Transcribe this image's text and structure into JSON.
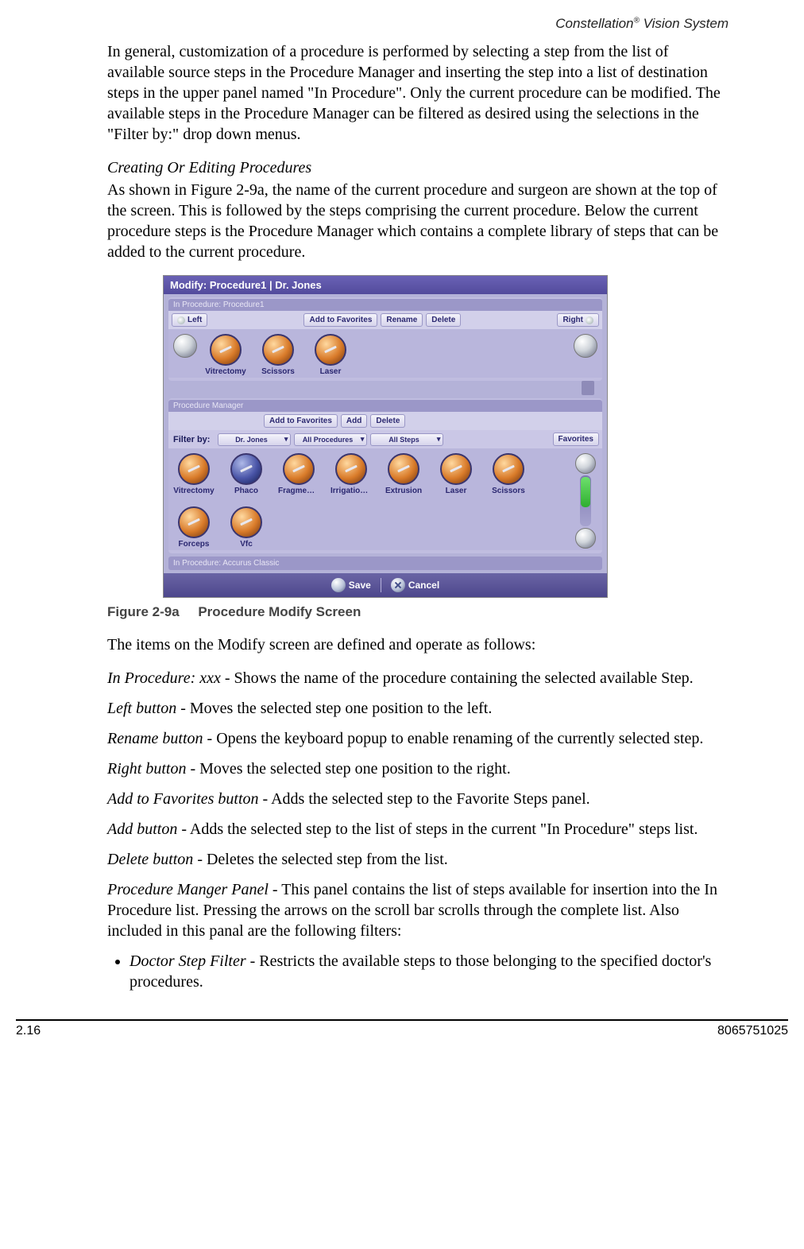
{
  "header": "Constellation® Vision System",
  "para1": "In general, customization of a procedure is performed by selecting a step from the list of available source steps in the Procedure Manager and inserting the step into a list of destination steps in the upper panel named \"In Procedure\".  Only the current procedure can be modified. The available steps in the Procedure Manager can be filtered as desired using the selections in the \"Filter by:\" drop down menus.",
  "subhead1": "Creating Or Editing Procedures",
  "para2": "As shown in Figure 2-9a, the name of the current procedure and surgeon are shown at the top of the screen. This is followed by the steps comprising the current procedure. Below the current procedure steps is the Procedure Manager which contains a complete library of steps that can be added to the current procedure.",
  "fig": {
    "caption_a": "Figure 2-9a",
    "caption_b": "Procedure Modify Screen",
    "titlebar": "Modify:   Procedure1  |  Dr. Jones",
    "inproc": {
      "title": "In Procedure:   Procedure1",
      "left": "Left",
      "addfav": "Add to Favorites",
      "rename": "Rename",
      "delete": "Delete",
      "right": "Right",
      "steps": [
        "Vitrectomy",
        "Scissors",
        "Laser"
      ]
    },
    "mgr": {
      "title": "Procedure Manager",
      "addfav": "Add to Favorites",
      "add": "Add",
      "delete": "Delete",
      "filter_label": "Filter by:",
      "filters": [
        "Dr. Jones",
        "All Procedures",
        "All Steps"
      ],
      "favorites": "Favorites",
      "steps": [
        "Vitrectomy",
        "Phaco",
        "Fragmentati",
        "IrrigationAs",
        "Extrusion",
        "Laser",
        "Scissors",
        "Forceps",
        "Vfc"
      ]
    },
    "subpanel": "In Procedure:   Accurus Classic",
    "save": "Save",
    "cancel": "Cancel"
  },
  "para3": "The items on the Modify screen are defined and operate as follows:",
  "defs": [
    {
      "t": "In Procedure: xxx",
      "d": " - Shows the name of the procedure containing the selected available Step."
    },
    {
      "t": "Left button",
      "d": " - Moves the selected step one position to the left."
    },
    {
      "t": "Rename button",
      "d": " - Opens the keyboard popup to enable renaming of the currently selected step."
    },
    {
      "t": "Right button",
      "d": " - Moves the selected step one position to the right."
    },
    {
      "t": "Add to Favorites button",
      "d": " - Adds the selected step to the Favorite Steps panel."
    },
    {
      "t": "Add button",
      "d": " - Adds the selected step to the list of steps in the current \"In Procedure\" steps list."
    },
    {
      "t": "Delete button",
      "d": " - Deletes the selected step from the list."
    },
    {
      "t": "Procedure Manger Panel",
      "d": " - This panel contains the list of steps available for insertion into the In Procedure list. Pressing the arrows on the scroll bar scrolls through the complete list. Also included in this panal are the following filters:"
    }
  ],
  "bullets": [
    {
      "t": "Doctor Step Filter",
      "d": " - Restricts the available steps to those belonging to the specified doctor's procedures."
    }
  ],
  "footer": {
    "left": "2.16",
    "right": "8065751025"
  }
}
